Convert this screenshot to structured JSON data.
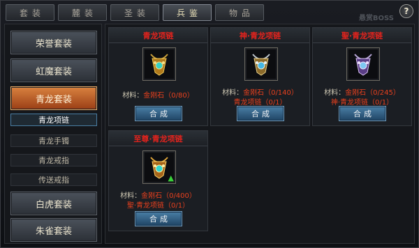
{
  "tabs": [
    {
      "label": "套装"
    },
    {
      "label": "麓装"
    },
    {
      "label": "圣装"
    },
    {
      "label": "兵鉴"
    },
    {
      "label": "物品"
    }
  ],
  "corner_text": "悬赏BOSS",
  "help_label": "?",
  "sidebar": {
    "sets": [
      {
        "label": "荣誉套装"
      },
      {
        "label": "虹魔套装"
      },
      {
        "label": "青龙套装"
      },
      {
        "label": "白虎套装"
      },
      {
        "label": "朱雀套装"
      }
    ],
    "subitems": [
      {
        "label": "青龙项链"
      },
      {
        "label": "青龙手镯"
      },
      {
        "label": "青龙戒指"
      },
      {
        "label": "传送戒指"
      }
    ]
  },
  "cards": [
    {
      "title": "青龙项链",
      "material_label": "材料：",
      "material": "金刚石（0/80）",
      "extra": "",
      "button": "合成"
    },
    {
      "title": "神·青龙项链",
      "material_label": "材料：",
      "material": "金刚石（0/140）",
      "extra": "青龙项链（0/1）",
      "button": "合成"
    },
    {
      "title": "聖·青龙项链",
      "material_label": "材料：",
      "material": "金刚石（0/245）",
      "extra": "神·青龙项链（0/1）",
      "button": "合成"
    },
    {
      "title": "至尊·青龙项链",
      "material_label": "材料：",
      "material": "金刚石（0/400）",
      "extra": "聖·青龙项链（0/1）",
      "button": "合成"
    }
  ],
  "colors": {
    "title_red": "#e4231d",
    "active_set": "#c46a2f",
    "craft_blue": "#2f6690"
  }
}
